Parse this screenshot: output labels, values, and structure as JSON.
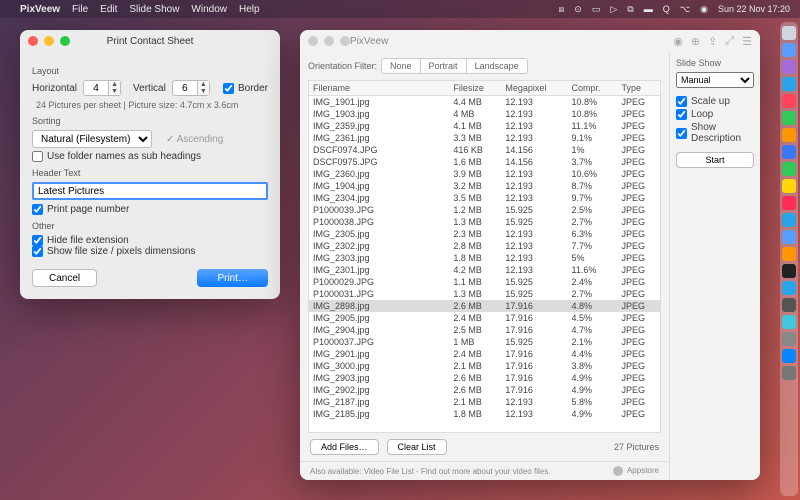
{
  "menubar": {
    "app": "PixVeew",
    "items": [
      "File",
      "Edit",
      "Slide Show",
      "Window",
      "Help"
    ],
    "clock": "Sun 22 Nov  17:20"
  },
  "dialog": {
    "title": "Print Contact Sheet",
    "layout_label": "Layout",
    "horizontal_label": "Horizontal",
    "horizontal_value": "4",
    "vertical_label": "Vertical",
    "vertical_value": "6",
    "border_label": "Border",
    "border_checked": true,
    "hint": "24 Pictures per sheet | Picture size: 4.7cm x 3.6cm",
    "sorting_label": "Sorting",
    "sort_value": "Natural (Filesystem)",
    "ascending_label": "Ascending",
    "subheadings_label": "Use folder names as sub headings",
    "subheadings_checked": false,
    "header_label": "Header Text",
    "header_value": "Latest Pictures",
    "pagenum_label": "Print page number",
    "pagenum_checked": true,
    "other_label": "Other",
    "hideext_label": "Hide file extension",
    "hideext_checked": true,
    "showsize_label": "Show file size / pixels dimensions",
    "showsize_checked": true,
    "cancel": "Cancel",
    "print": "Print…"
  },
  "main": {
    "title": "PixVeew",
    "orientation_label": "Orientation Filter:",
    "segs": [
      "None",
      "Portrait",
      "Landscape"
    ],
    "cols": [
      "Filename",
      "Filesize",
      "Megapixel",
      "Compr.",
      "Type"
    ],
    "rows": [
      [
        "IMG_1901.jpg",
        "4.4 MB",
        "12.193",
        "10.8%",
        "JPEG"
      ],
      [
        "IMG_1903.jpg",
        "4 MB",
        "12.193",
        "10.8%",
        "JPEG"
      ],
      [
        "IMG_2359.jpg",
        "4.1 MB",
        "12.193",
        "11.1%",
        "JPEG"
      ],
      [
        "IMG_2361.jpg",
        "3.3 MB",
        "12.193",
        "9.1%",
        "JPEG"
      ],
      [
        "DSCF0974.JPG",
        "416 KB",
        "14.156",
        "1%",
        "JPEG"
      ],
      [
        "DSCF0975.JPG",
        "1.6 MB",
        "14.156",
        "3.7%",
        "JPEG"
      ],
      [
        "IMG_2360.jpg",
        "3.9 MB",
        "12.193",
        "10.6%",
        "JPEG"
      ],
      [
        "IMG_1904.jpg",
        "3.2 MB",
        "12.193",
        "8.7%",
        "JPEG"
      ],
      [
        "IMG_2304.jpg",
        "3.5 MB",
        "12.193",
        "9.7%",
        "JPEG"
      ],
      [
        "P1000039.JPG",
        "1.2 MB",
        "15.925",
        "2.5%",
        "JPEG"
      ],
      [
        "P1000038.JPG",
        "1.3 MB",
        "15.925",
        "2.7%",
        "JPEG"
      ],
      [
        "IMG_2305.jpg",
        "2.3 MB",
        "12.193",
        "6.3%",
        "JPEG"
      ],
      [
        "IMG_2302.jpg",
        "2.8 MB",
        "12.193",
        "7.7%",
        "JPEG"
      ],
      [
        "IMG_2303.jpg",
        "1.8 MB",
        "12.193",
        "5%",
        "JPEG"
      ],
      [
        "IMG_2301.jpg",
        "4.2 MB",
        "12.193",
        "11.6%",
        "JPEG"
      ],
      [
        "P1000029.JPG",
        "1.1 MB",
        "15.925",
        "2.4%",
        "JPEG"
      ],
      [
        "P1000031.JPG",
        "1.3 MB",
        "15.925",
        "2.7%",
        "JPEG"
      ],
      [
        "IMG_2898.jpg",
        "2.6 MB",
        "17.916",
        "4.8%",
        "JPEG"
      ],
      [
        "IMG_2905.jpg",
        "2.4 MB",
        "17.916",
        "4.5%",
        "JPEG"
      ],
      [
        "IMG_2904.jpg",
        "2.5 MB",
        "17.916",
        "4.7%",
        "JPEG"
      ],
      [
        "P1000037.JPG",
        "1 MB",
        "15.925",
        "2.1%",
        "JPEG"
      ],
      [
        "IMG_2901.jpg",
        "2.4 MB",
        "17.916",
        "4.4%",
        "JPEG"
      ],
      [
        "IMG_3000.jpg",
        "2.1 MB",
        "17.916",
        "3.8%",
        "JPEG"
      ],
      [
        "IMG_2903.jpg",
        "2.6 MB",
        "17.916",
        "4.9%",
        "JPEG"
      ],
      [
        "IMG_2902.jpg",
        "2.6 MB",
        "17.916",
        "4.9%",
        "JPEG"
      ],
      [
        "IMG_2187.jpg",
        "2.1 MB",
        "12.193",
        "5.8%",
        "JPEG"
      ],
      [
        "IMG_2185.jpg",
        "1.8 MB",
        "12.193",
        "4.9%",
        "JPEG"
      ]
    ],
    "selected_index": 17,
    "add_files": "Add Files…",
    "clear_list": "Clear List",
    "count": "27 Pictures",
    "footer": "Also available: Video File List - Find out more about your video files.",
    "appstore": "Appstore",
    "sidebar": {
      "title": "Slide Show",
      "mode": "Manual",
      "scaleup": "Scale up",
      "loop": "Loop",
      "showdesc": "Show Description",
      "start": "Start"
    }
  },
  "dock_colors": [
    "#cfd6e0",
    "#5a9eff",
    "#a66bd4",
    "#2aa4e8",
    "#ff4559",
    "#34c759",
    "#ff9500",
    "#3a79ff",
    "#34c759",
    "#ffd60a",
    "#ff2d55",
    "#2aa4e8",
    "#5a9eff",
    "#ff9500",
    "#222",
    "#2aa4e8",
    "#555",
    "#40c8e0",
    "#888",
    "#0a84ff",
    "#777"
  ]
}
